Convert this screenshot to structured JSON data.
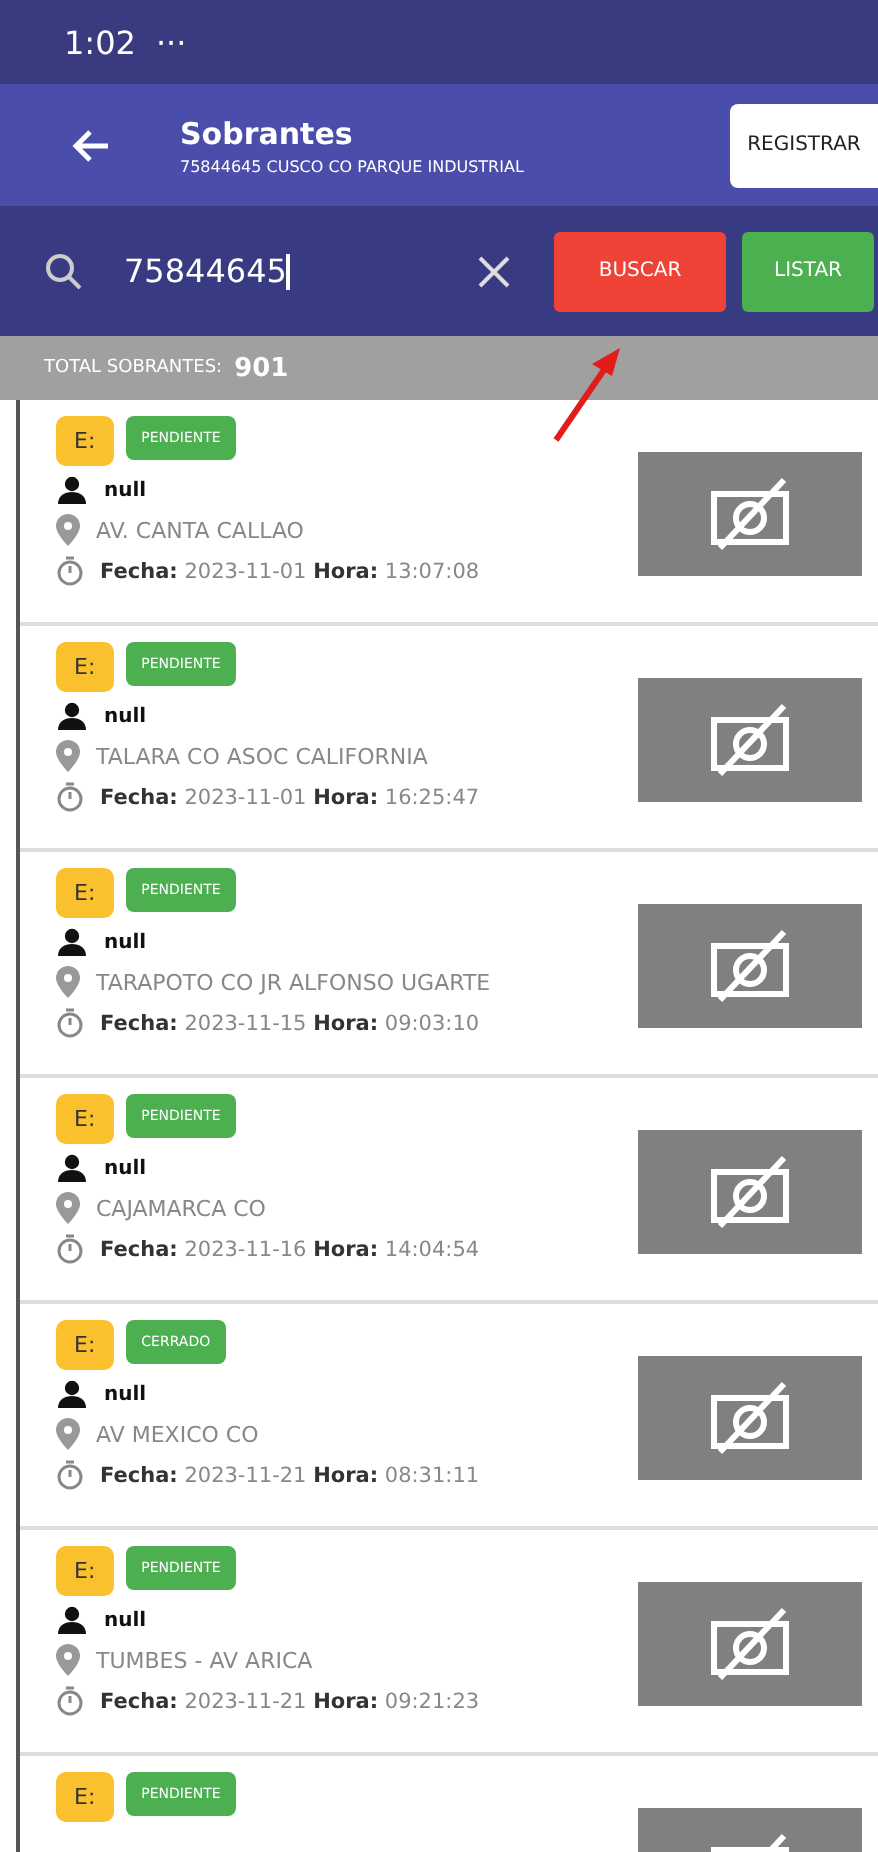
{
  "status_bar": {
    "time": "1:02",
    "dots": "···"
  },
  "header": {
    "title": "Sobrantes",
    "subtitle": "75844645 CUSCO CO PARQUE INDUSTRIAL",
    "action": "REGISTRAR"
  },
  "search": {
    "value": "75844645",
    "buttons": [
      {
        "label": "BUSCAR",
        "kind": "danger"
      },
      {
        "label": "LISTAR",
        "kind": "success"
      }
    ]
  },
  "total": {
    "label": "TOTAL SOBRANTES:",
    "value": "901"
  },
  "items": [
    {
      "badge": "E:",
      "status": "PENDIENTE",
      "person": "null",
      "address": "AV. CANTA CALLAO",
      "date_label": "Fecha:",
      "date": "2023-11-01",
      "time_label": "Hora:",
      "time": "13:07:08"
    },
    {
      "badge": "E:",
      "status": "PENDIENTE",
      "person": "null",
      "address": "TALARA  CO ASOC CALIFORNIA",
      "date_label": "Fecha:",
      "date": "2023-11-01",
      "time_label": "Hora:",
      "time": "16:25:47"
    },
    {
      "badge": "E:",
      "status": "PENDIENTE",
      "person": "null",
      "address": "TARAPOTO CO JR ALFONSO UGARTE",
      "date_label": "Fecha:",
      "date": "2023-11-15",
      "time_label": "Hora:",
      "time": "09:03:10"
    },
    {
      "badge": "E:",
      "status": "PENDIENTE",
      "person": "null",
      "address": "CAJAMARCA CO",
      "date_label": "Fecha:",
      "date": "2023-11-16",
      "time_label": "Hora:",
      "time": "14:04:54"
    },
    {
      "badge": "E:",
      "status": "CERRADO",
      "person": "null",
      "address": "AV MEXICO CO",
      "date_label": "Fecha:",
      "date": "2023-11-21",
      "time_label": "Hora:",
      "time": "08:31:11"
    },
    {
      "badge": "E:",
      "status": "PENDIENTE",
      "person": "null",
      "address": "TUMBES - AV ARICA",
      "date_label": "Fecha:",
      "date": "2023-11-21",
      "time_label": "Hora:",
      "time": "09:21:23"
    },
    {
      "badge": "E:",
      "status": "PENDIENTE"
    }
  ]
}
